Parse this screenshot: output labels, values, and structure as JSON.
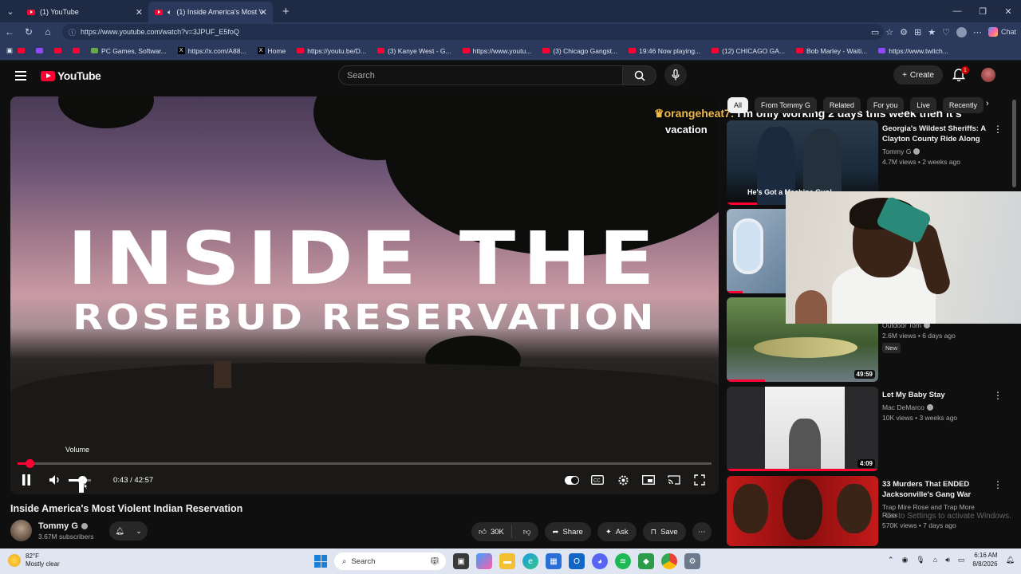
{
  "browser": {
    "tabs": [
      {
        "title": "(1) YouTube",
        "active": false
      },
      {
        "title": "(1) Inside America's Most Violi",
        "active": true
      }
    ],
    "url": "https://www.youtube.com/watch?v=3JPUF_E5foQ",
    "chat_label": "Chat",
    "bookmarks": [
      {
        "label": "",
        "icon": "youtube"
      },
      {
        "label": "",
        "icon": "twitch"
      },
      {
        "label": "",
        "icon": "youtube"
      },
      {
        "label": "",
        "icon": "youtube"
      },
      {
        "label": "PC Games, Softwar...",
        "icon": "game"
      },
      {
        "label": "https://x.com/A88...",
        "icon": "x"
      },
      {
        "label": "Home",
        "icon": "x"
      },
      {
        "label": "https://youtu.be/D...",
        "icon": "youtube"
      },
      {
        "label": "(3) Kanye West - G...",
        "icon": "youtube"
      },
      {
        "label": "https://www.youtu...",
        "icon": "youtube"
      },
      {
        "label": "(3) Chicago Gangst...",
        "icon": "youtube"
      },
      {
        "label": "19:46 Now playing...",
        "icon": "youtube"
      },
      {
        "label": "(12) CHICAGO GA...",
        "icon": "youtube"
      },
      {
        "label": "Bob Marley - Waiti...",
        "icon": "youtube"
      },
      {
        "label": "https://www.twitch...",
        "icon": "twitch"
      }
    ]
  },
  "youtube": {
    "logo_text": "YouTube",
    "search_placeholder": "Search",
    "create_label": "Create",
    "notification_count": "1"
  },
  "player": {
    "thumb_line1": "INSIDE THE",
    "thumb_line2": "ROSEBUD RESERVATION",
    "chat_user": "orangeheat7:",
    "chat_msg": "I'm only working 2 days this week then it's",
    "chat_msg2": "vacation",
    "volume_tooltip": "Volume",
    "time": "0:43 / 42:57",
    "progress_fraction": 0.017,
    "volume_fraction": 0.6
  },
  "video": {
    "title": "Inside America's Most Violent Indian Reservation",
    "channel": "Tommy G",
    "subscribers": "3.67M subscribers",
    "likes": "30K",
    "share": "Share",
    "ask": "Ask",
    "save": "Save"
  },
  "chips": [
    "All",
    "From Tommy G",
    "Related",
    "For you",
    "Live",
    "Recently"
  ],
  "recommendations": [
    {
      "title": "Georgia's Wildest Sheriffs: A Clayton County Ride Along",
      "channel": "Tommy G",
      "stats": "4.7M views • 2 weeks ago",
      "overlay": "He's Got a Machine Gun!",
      "duration": "",
      "badge": "",
      "watched_fraction": 0.2
    },
    {
      "title": "",
      "channel": "",
      "stats": "",
      "overlay": "",
      "duration": "",
      "badge": "",
      "watched_fraction": 0.1
    },
    {
      "title": "",
      "channel": "Outdoor Tom",
      "stats": "2.6M views • 6 days ago",
      "overlay": "",
      "duration": "49:59",
      "badge": "New",
      "watched_fraction": 0.25
    },
    {
      "title": "Let My Baby Stay",
      "channel": "Mac DeMarco",
      "stats": "10K views • 3 weeks ago",
      "overlay": "",
      "duration": "4:09",
      "badge": "",
      "watched_fraction": 1.0
    },
    {
      "title": "33 Murders That ENDED Jacksonville's Gang War",
      "channel": "Trap Mire Rose and Trap More Ross",
      "stats": "570K views • 7 days ago",
      "overlay": "",
      "duration": "",
      "badge": "",
      "watched_fraction": 0
    }
  ],
  "watermark": [
    "Go to Settings to activate Windows."
  ],
  "taskbar": {
    "temperature": "82°F",
    "condition": "Mostly clear",
    "search": "Search",
    "time": "6:16 AM",
    "date": "8/8/2026"
  },
  "colors": {
    "accent": "#ff0033",
    "bg": "#0f0f0f",
    "chrome": "#2b3a5c"
  }
}
